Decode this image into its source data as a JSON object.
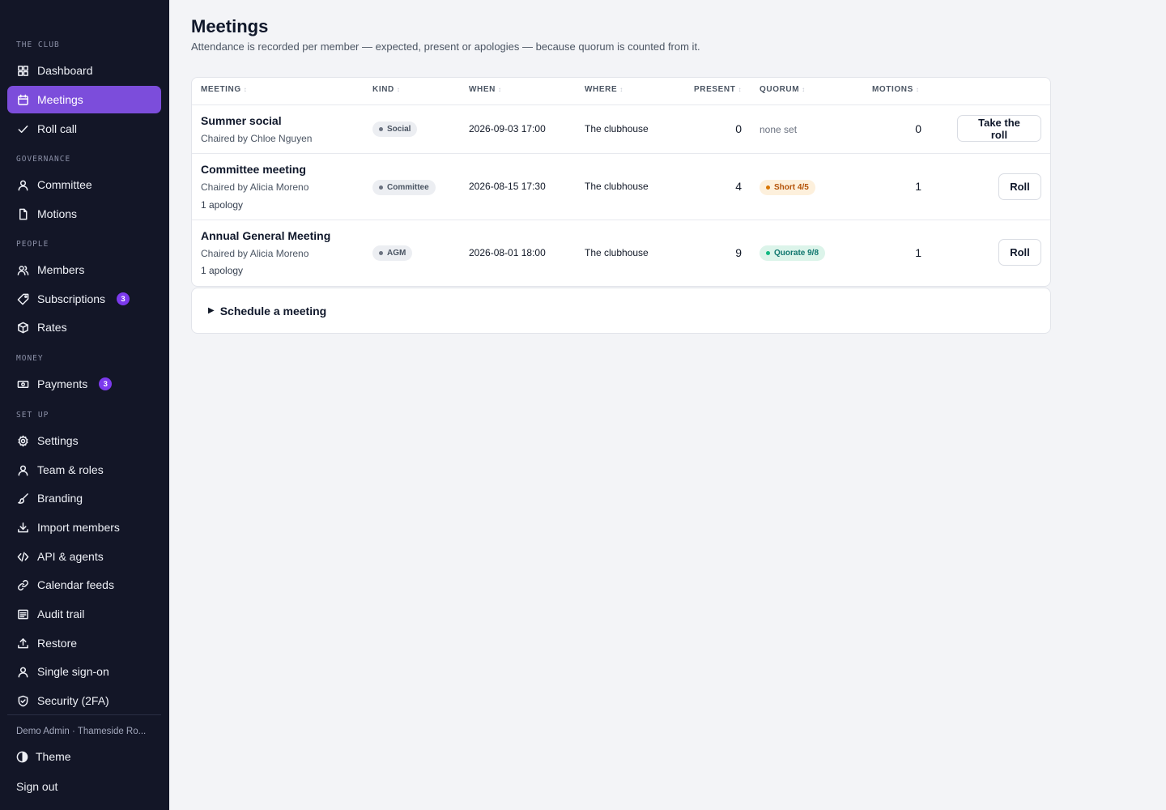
{
  "sidebar": {
    "sections": {
      "club": "THE CLUB",
      "governance": "GOVERNANCE",
      "people": "PEOPLE",
      "money": "MONEY",
      "setup": "SET UP"
    },
    "items": {
      "dashboard": "Dashboard",
      "meetings": "Meetings",
      "rollcall": "Roll call",
      "committee": "Committee",
      "motions": "Motions",
      "members": "Members",
      "subscriptions": "Subscriptions",
      "subscriptions_badge": "3",
      "rates": "Rates",
      "payments": "Payments",
      "payments_badge": "3",
      "settings": "Settings",
      "team": "Team & roles",
      "branding": "Branding",
      "import": "Import members",
      "api": "API & agents",
      "calendar": "Calendar feeds",
      "audit": "Audit trail",
      "restore": "Restore",
      "sso": "Single sign-on",
      "security": "Security (2FA)"
    },
    "user": "Demo Admin · Thameside Ro...",
    "theme": "Theme",
    "signout": "Sign out"
  },
  "page": {
    "title": "Meetings",
    "subtitle": "Attendance is recorded per member — expected, present or apologies — because quorum is counted from it."
  },
  "table": {
    "headers": {
      "meeting": "MEETING",
      "kind": "KIND",
      "when": "WHEN",
      "where": "WHERE",
      "present": "PRESENT",
      "quorum": "QUORUM",
      "motions": "MOTIONS"
    },
    "rows": [
      {
        "title": "Summer social",
        "chair": "Chaired by Chloe Nguyen",
        "apologies": "",
        "kind": "Social",
        "when": "2026-09-03 17:00",
        "where": "The clubhouse",
        "present": "0",
        "quorum": "none set",
        "motions": "0",
        "action": "Take the roll"
      },
      {
        "title": "Committee meeting",
        "chair": "Chaired by Alicia Moreno",
        "apologies": "1 apology",
        "kind": "Committee",
        "when": "2026-08-15 17:30",
        "where": "The clubhouse",
        "present": "4",
        "quorum": "Short 4/5",
        "motions": "1",
        "action": "Roll"
      },
      {
        "title": "Annual General Meeting",
        "chair": "Chaired by Alicia Moreno",
        "apologies": "1 apology",
        "kind": "AGM",
        "when": "2026-08-01 18:00",
        "where": "The clubhouse",
        "present": "9",
        "quorum": "Quorate 9/8",
        "motions": "1",
        "action": "Roll"
      }
    ]
  },
  "schedule": {
    "label": "Schedule a meeting"
  },
  "colors": {
    "accent": "#7c4ddb",
    "sidebar_bg": "#131627",
    "short": "#b45309",
    "quorate": "#0f766e"
  }
}
